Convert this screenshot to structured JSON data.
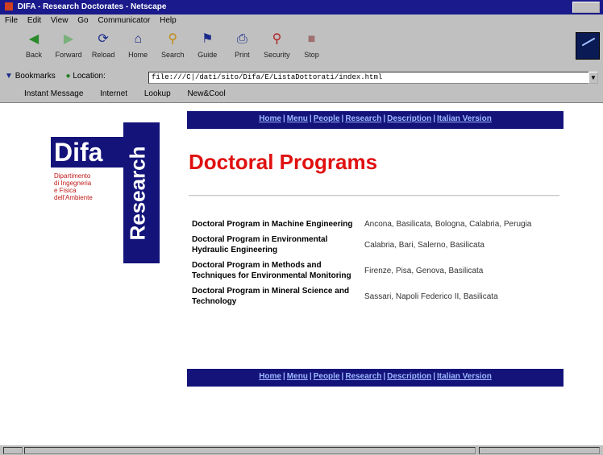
{
  "window": {
    "title": "DIFA - Research Doctorates - Netscape"
  },
  "menubar": {
    "items": [
      "File",
      "Edit",
      "View",
      "Go",
      "Communicator",
      "Help"
    ]
  },
  "toolbar": {
    "buttons": [
      {
        "label": "Back",
        "icon": "back-arrow"
      },
      {
        "label": "Forward",
        "icon": "forward-arrow"
      },
      {
        "label": "Reload",
        "icon": "reload"
      },
      {
        "label": "Home",
        "icon": "home"
      },
      {
        "label": "Search",
        "icon": "search"
      },
      {
        "label": "Guide",
        "icon": "guide"
      },
      {
        "label": "Print",
        "icon": "print"
      },
      {
        "label": "Security",
        "icon": "lock"
      },
      {
        "label": "Stop",
        "icon": "stop"
      }
    ]
  },
  "location": {
    "bookmarks_label": "Bookmarks",
    "location_label": "Location:",
    "url": "file:///C|/dati/sito/Difa/E/ListaDottorati/index.html"
  },
  "personal_toolbar": {
    "items": [
      "Instant Message",
      "Internet",
      "Lookup",
      "New&Cool"
    ]
  },
  "logo": {
    "name": "Difa",
    "vertical": "Research",
    "dept_lines": [
      "Dipartimento",
      "di Ingegneria",
      "e Fisica",
      "dell'Ambiente"
    ]
  },
  "nav": {
    "links": [
      "Home",
      "Menu",
      "People",
      "Research",
      "Description",
      "Italian Version"
    ]
  },
  "page": {
    "title": "Doctoral Programs"
  },
  "programs": [
    {
      "name": "Doctoral Program in Machine Engineering",
      "places": "Ancona, Basilicata, Bologna, Calabria, Perugia"
    },
    {
      "name": "Doctoral Program in Environmental Hydraulic Engineering",
      "places": "Calabria, Bari, Salerno, Basilicata"
    },
    {
      "name": "Doctoral Program in Methods and Techniques for Environmental Monitoring",
      "places": "Firenze, Pisa, Genova, Basilicata"
    },
    {
      "name": "Doctoral Program in Mineral Science and Technology",
      "places": "Sassari, Napoli Federico II, Basilicata"
    }
  ],
  "colors": {
    "nav_bg": "#13137a",
    "title_red": "#e01010",
    "chrome": "#c0c0c0"
  }
}
